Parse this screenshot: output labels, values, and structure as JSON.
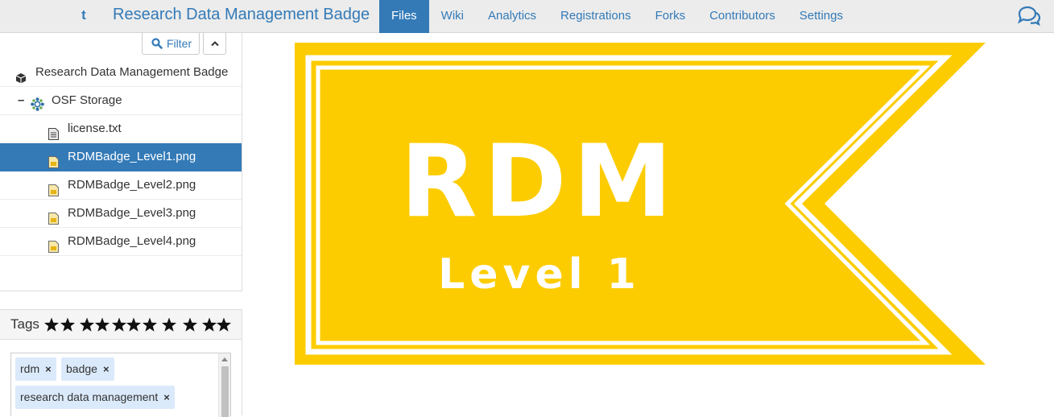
{
  "navbar": {
    "project_title": "Research Data Management Badge",
    "up_icon": "t",
    "tabs": [
      {
        "label": "Files",
        "active": true
      },
      {
        "label": "Wiki",
        "active": false
      },
      {
        "label": "Analytics",
        "active": false
      },
      {
        "label": "Registrations",
        "active": false
      },
      {
        "label": "Forks",
        "active": false
      },
      {
        "label": "Contributors",
        "active": false
      },
      {
        "label": "Settings",
        "active": false
      }
    ],
    "comments_icon": "comments-icon"
  },
  "filetree": {
    "filter_label": "Filter",
    "items": [
      {
        "label": "Research Data Management Badge",
        "type": "project",
        "icon": "cube-icon",
        "selected": false
      },
      {
        "label": "OSF Storage",
        "type": "provider",
        "icon": "osf-storage-icon",
        "toggle": "–",
        "selected": false
      },
      {
        "label": "license.txt",
        "type": "file",
        "icon": "text-file-icon",
        "selected": false
      },
      {
        "label": "RDMBadge_Level1.png",
        "type": "file",
        "icon": "image-file-icon",
        "selected": true
      },
      {
        "label": "RDMBadge_Level2.png",
        "type": "file",
        "icon": "image-file-icon",
        "selected": false
      },
      {
        "label": "RDMBadge_Level3.png",
        "type": "file",
        "icon": "image-file-icon",
        "selected": false
      },
      {
        "label": "RDMBadge_Level4.png",
        "type": "file",
        "icon": "image-file-icon",
        "selected": false
      }
    ]
  },
  "tags": {
    "title": "Tags",
    "items": [
      "rdm",
      "badge",
      "research data management"
    ],
    "remove_glyph": "×"
  },
  "preview": {
    "badge_line1": "RDM",
    "badge_line2": "Level 1",
    "colors": {
      "badge_yellow": "#fccc00",
      "badge_text": "#ffffff"
    }
  },
  "colors": {
    "accent": "#337ab7",
    "navbar_bg": "#ececec",
    "tag_bg": "#dbeafb"
  }
}
